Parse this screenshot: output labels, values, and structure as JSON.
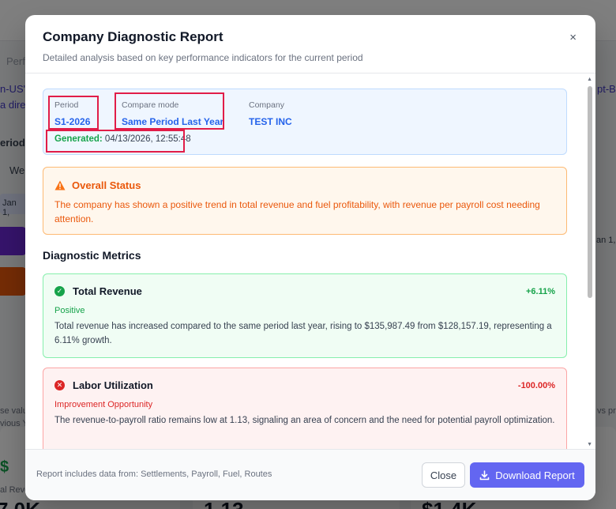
{
  "background": {
    "snippets": [
      "Perfo",
      "n-US\":",
      "pt-B",
      "a direc",
      "eriod",
      "We",
      "Jan 1,",
      "an 1,",
      "se valu",
      "vious Y",
      "vs pre",
      "al Reve",
      "$",
      "7.0K",
      "1.13",
      "$1.4K"
    ]
  },
  "modal": {
    "title": "Company Diagnostic Report",
    "subtitle": "Detailed analysis based on key performance indicators for the current period",
    "close_icon": "×"
  },
  "info": {
    "period_label": "Period",
    "period_value": "S1-2026",
    "compare_label": "Compare mode",
    "compare_value": "Same Period Last Year",
    "company_label": "Company",
    "company_value": "TEST INC",
    "generated_label": "Generated:",
    "generated_value": "04/13/2026, 12:55:48"
  },
  "status": {
    "title": "Overall Status",
    "text": "The company has shown a positive trend in total revenue and fuel profitability, with revenue per payroll cost needing attention."
  },
  "metrics_section": {
    "title": "Diagnostic Metrics",
    "items": [
      {
        "name": "Total Revenue",
        "change": "+6.11%",
        "status": "Positive",
        "description": "Total revenue has increased compared to the same period last year, rising to $135,987.49 from $128,157.19, representing a 6.11% growth."
      },
      {
        "name": "Labor Utilization",
        "change": "-100.00%",
        "status": "Improvement Opportunity",
        "description": "The revenue-to-payroll ratio remains low at 1.13, signaling an area of concern and the need for potential payroll optimization."
      }
    ]
  },
  "footer": {
    "note": "Report includes data from: Settlements, Payroll, Fuel, Routes",
    "close_label": "Close",
    "download_label": "Download Report"
  },
  "colors": {
    "accent": "#6366f1",
    "highlight_border": "#e11d48",
    "positive": "#16a34a",
    "negative": "#dc2626",
    "warning": "#ea580c"
  }
}
